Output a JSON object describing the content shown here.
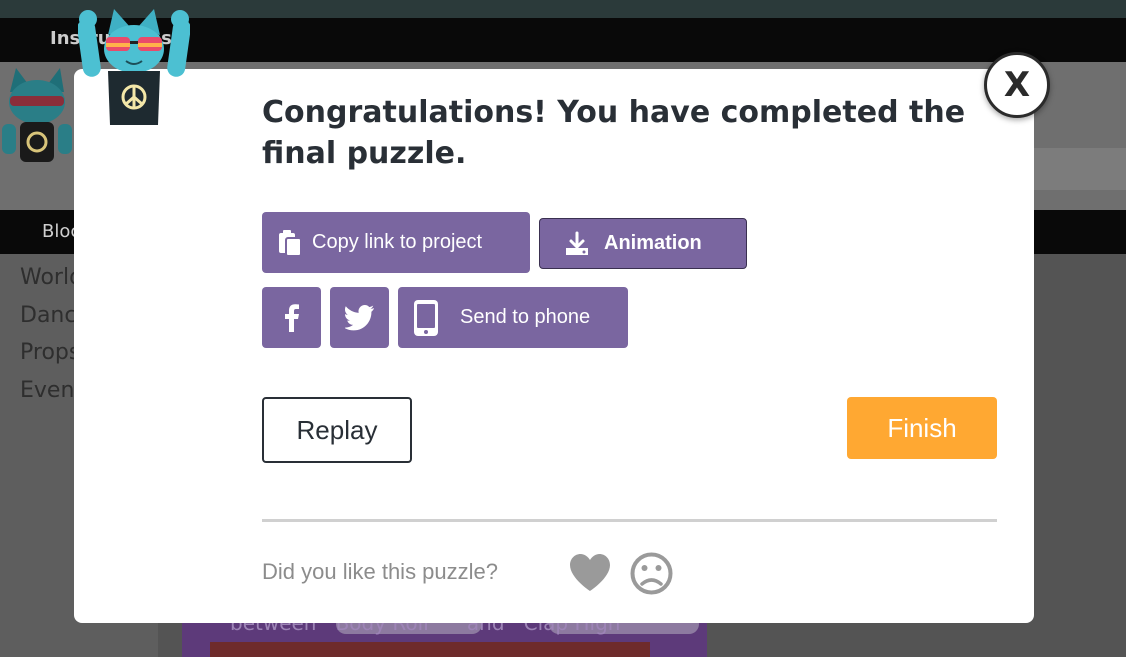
{
  "background": {
    "instructions_tab": "Instructions",
    "blocks_tab": "Blocks",
    "toolbox_categories": [
      "World",
      "Dance",
      "Props",
      "Events"
    ],
    "workspace_block": {
      "prefix": "between",
      "first_move": "Body Roll",
      "joiner": "and",
      "second_move": "Clap High"
    }
  },
  "modal": {
    "close_label": "X",
    "title": "Congratulations! You have completed the final puzzle.",
    "share": {
      "copy_link_label": "Copy link to project",
      "animation_label": "Animation",
      "send_to_phone_label": "Send to phone",
      "facebook_icon": "facebook-icon",
      "twitter_icon": "twitter-icon"
    },
    "replay_label": "Replay",
    "finish_label": "Finish",
    "feedback": {
      "question": "Did you like this puzzle?",
      "like_icon": "heart-icon",
      "dislike_icon": "frown-icon"
    }
  },
  "colors": {
    "share_purple": "#7a66a0",
    "finish_orange": "#ffa832",
    "text_dark": "#292f36",
    "feedback_gray": "#8c8c8c"
  }
}
